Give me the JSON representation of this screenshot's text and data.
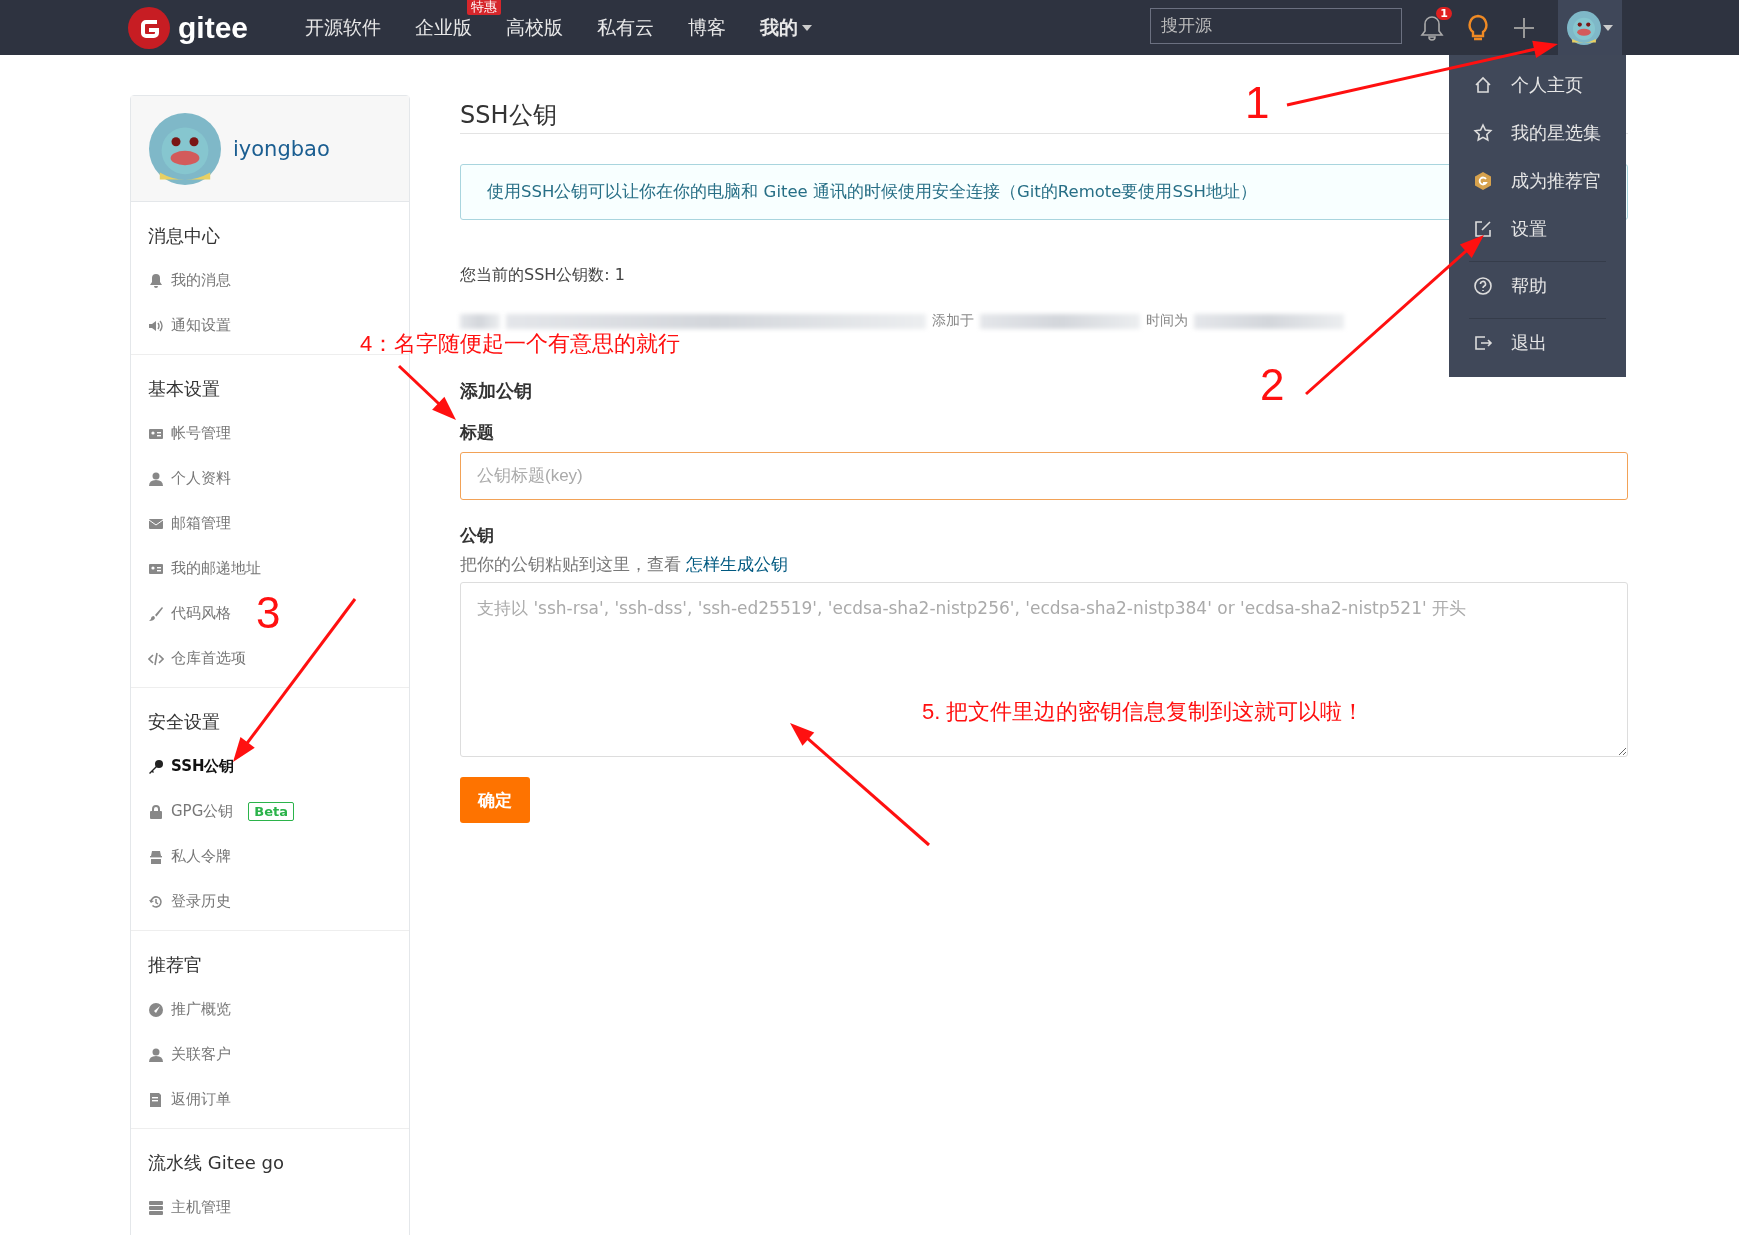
{
  "navbar": {
    "logo": "gitee",
    "links": [
      {
        "label": "开源软件",
        "dropdown": false
      },
      {
        "label": "企业版",
        "badge": "特惠",
        "dropdown": false
      },
      {
        "label": "高校版",
        "dropdown": false
      },
      {
        "label": "私有云",
        "dropdown": false
      },
      {
        "label": "博客",
        "dropdown": false
      },
      {
        "label": "我的",
        "dropdown": true
      }
    ],
    "search": {
      "placeholder": "搜开源"
    },
    "notification_count": "1"
  },
  "user_menu": {
    "items": [
      {
        "kind": "home",
        "label": "个人主页",
        "divider_before": false
      },
      {
        "kind": "star",
        "label": "我的星选集",
        "divider_before": false
      },
      {
        "kind": "badge",
        "label": "成为推荐官",
        "divider_before": false
      },
      {
        "kind": "edit",
        "label": "设置",
        "divider_before": false
      },
      {
        "kind": "help",
        "label": "帮助",
        "divider_before": true
      },
      {
        "kind": "logout",
        "label": "退出",
        "divider_before": true
      }
    ]
  },
  "sidebar": {
    "username": "iyongbao",
    "sections": [
      {
        "title": "消息中心",
        "items": [
          {
            "label": "我的消息",
            "selected": false
          },
          {
            "label": "通知设置",
            "selected": false
          }
        ]
      },
      {
        "title": "基本设置",
        "items": [
          {
            "label": "帐号管理",
            "selected": false
          },
          {
            "label": "个人资料",
            "selected": false
          },
          {
            "label": "邮箱管理",
            "selected": false
          },
          {
            "label": "我的邮递地址",
            "selected": false
          },
          {
            "label": "代码风格",
            "selected": false
          },
          {
            "label": "仓库首选项",
            "selected": false
          }
        ]
      },
      {
        "title": "安全设置",
        "items": [
          {
            "label": "SSH公钥",
            "selected": true
          },
          {
            "label": "GPG公钥",
            "badge": "Beta",
            "selected": false
          },
          {
            "label": "私人令牌",
            "selected": false
          },
          {
            "label": "登录历史",
            "selected": false
          }
        ]
      },
      {
        "title": "推荐官",
        "items": [
          {
            "label": "推广概览",
            "selected": false
          },
          {
            "label": "关联客户",
            "selected": false
          },
          {
            "label": "返佣订单",
            "selected": false
          }
        ]
      },
      {
        "title": "流水线 Gitee go",
        "items": [
          {
            "label": "主机管理",
            "selected": false
          }
        ]
      }
    ]
  },
  "main": {
    "title": "SSH公钥",
    "info": "使用SSH公钥可以让你在你的电脑和 Gitee 通讯的时候使用安全连接（Git的Remote要使用SSH地址）",
    "key_count": "您当前的SSH公钥数: 1",
    "key_row": {
      "added_label": "添加于",
      "time_label": "时间为"
    },
    "add_heading": "添加公钥",
    "title_field": {
      "label": "标题",
      "placeholder": "公钥标题(key)"
    },
    "key_field": {
      "label": "公钥",
      "hint": "把你的公钥粘贴到这里，查看 ",
      "hint_link": "怎样生成公钥",
      "placeholder": "支持以 'ssh-rsa', 'ssh-dss', 'ssh-ed25519', 'ecdsa-sha2-nistp256', 'ecdsa-sha2-nistp384' or 'ecdsa-sha2-nistp521' 开头"
    },
    "submit": "确定"
  },
  "annotations": [
    {
      "kind": "number",
      "text": "1"
    },
    {
      "kind": "number",
      "text": "2"
    },
    {
      "kind": "number",
      "text": "3"
    },
    {
      "kind": "note",
      "text": "4：名字随便起一个有意思的就行"
    },
    {
      "kind": "note",
      "text": "5. 把文件里边的密钥信息复制到这就可以啦！"
    }
  ]
}
